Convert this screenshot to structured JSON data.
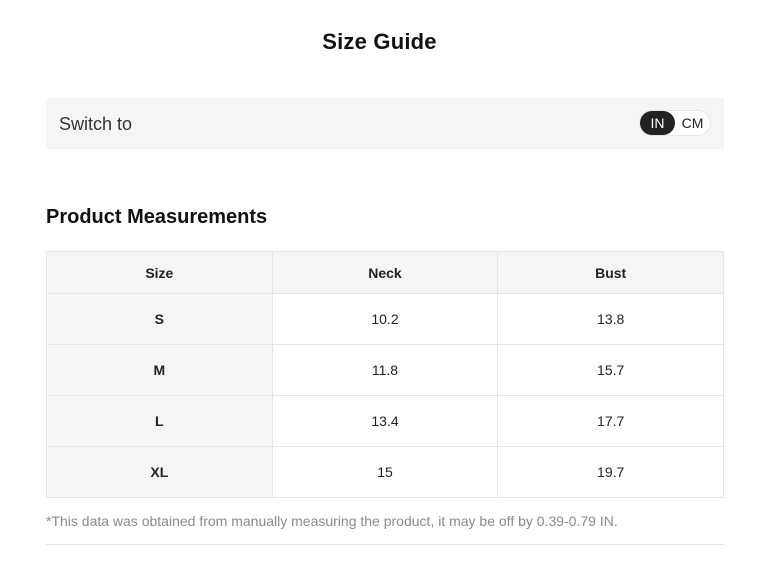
{
  "page": {
    "title": "Size Guide"
  },
  "unit_switch": {
    "label": "Switch to",
    "options": [
      "IN",
      "CM"
    ],
    "selected": "IN",
    "active_color": "#222222"
  },
  "measurements": {
    "heading": "Product Measurements",
    "columns": [
      "Size",
      "Neck",
      "Bust"
    ],
    "rows": [
      [
        "S",
        "10.2",
        "13.8"
      ],
      [
        "M",
        "11.8",
        "15.7"
      ],
      [
        "L",
        "13.4",
        "17.7"
      ],
      [
        "XL",
        "15",
        "19.7"
      ]
    ],
    "footnote": "*This data was obtained from manually measuring the product, it may be off by 0.39-0.79 IN."
  }
}
